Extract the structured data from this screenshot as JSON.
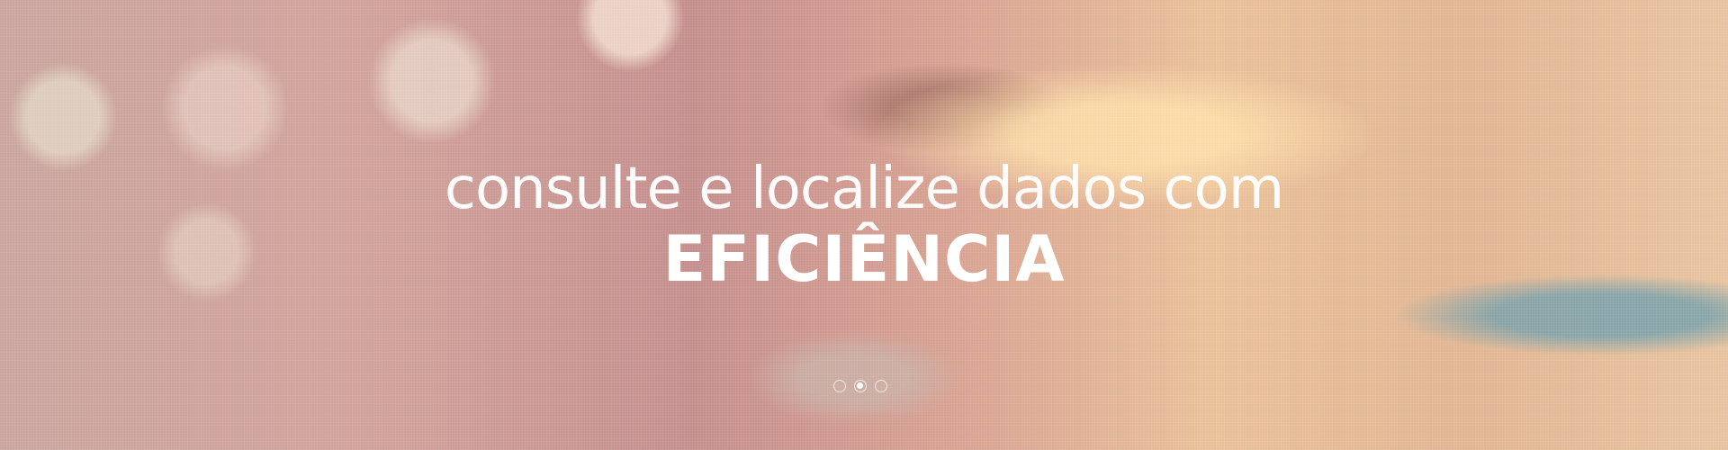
{
  "hero": {
    "headline": "consulte e localize dados com",
    "emphasis": "EFICIÊNCIA",
    "slides": {
      "count": 3,
      "active_index": 1
    }
  },
  "colors": {
    "text": "#ffffff"
  }
}
